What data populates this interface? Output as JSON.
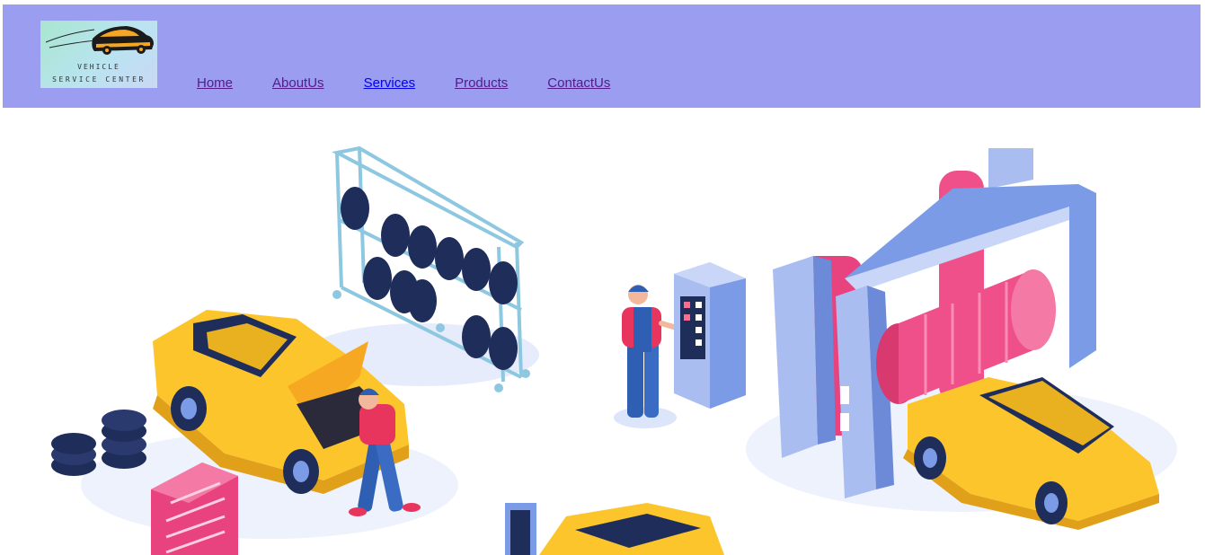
{
  "logo": {
    "line1": "VEHICLE",
    "line2": "SERVICE CENTER"
  },
  "nav": {
    "items": [
      {
        "label": "Home"
      },
      {
        "label": "AboutUs"
      },
      {
        "label": "Services"
      },
      {
        "label": "Products"
      },
      {
        "label": "ContactUs"
      }
    ]
  },
  "colors": {
    "header_bg": "#9b9df0",
    "link_visited": "#551a8b",
    "link_unvisited": "#0000ee",
    "car_yellow": "#fcc52c",
    "brush_pink": "#f0508a",
    "machine_blue": "#7b9be6"
  }
}
